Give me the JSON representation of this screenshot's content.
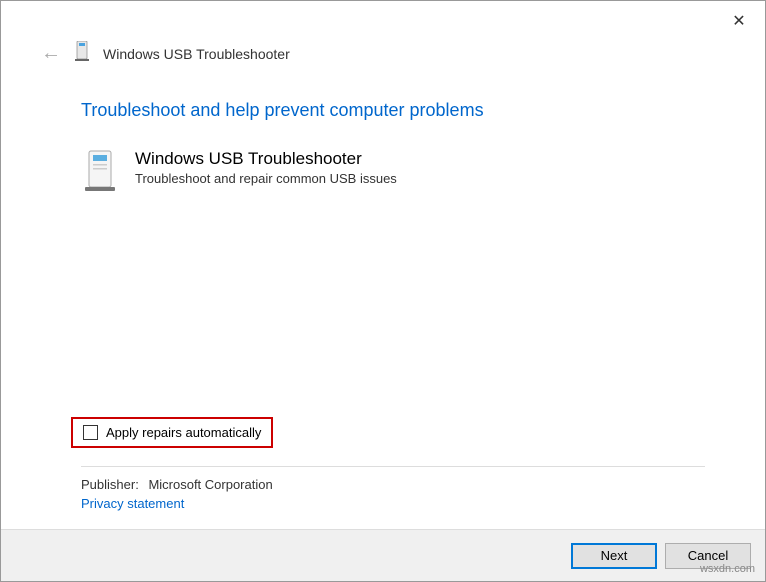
{
  "window": {
    "title": "Windows USB Troubleshooter"
  },
  "content": {
    "heading": "Troubleshoot and help prevent computer problems",
    "item_title": "Windows USB Troubleshooter",
    "item_desc": "Troubleshoot and repair common USB issues",
    "checkbox_label": "Apply repairs automatically",
    "publisher_label": "Publisher:",
    "publisher_value": "Microsoft Corporation",
    "privacy": "Privacy statement"
  },
  "footer": {
    "next": "Next",
    "cancel": "Cancel"
  },
  "watermark": "wsxdn.com"
}
